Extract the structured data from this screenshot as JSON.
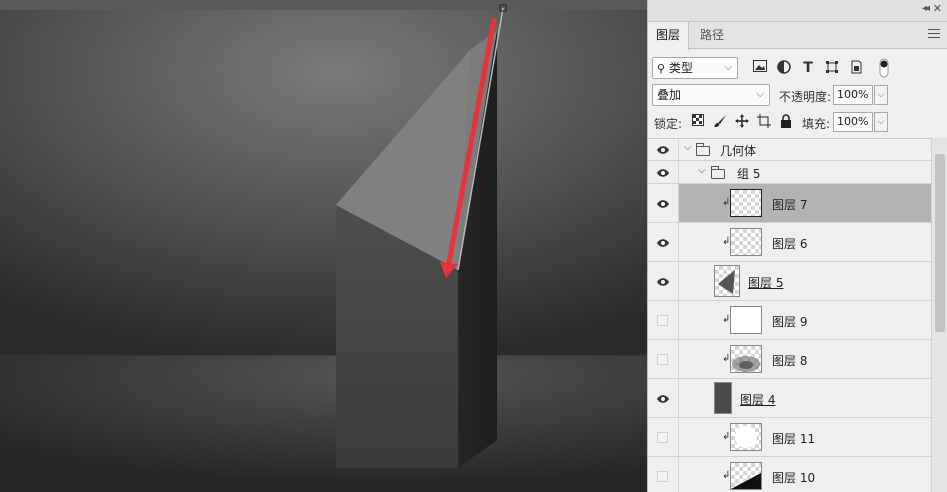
{
  "panel": {
    "tabs": [
      {
        "label": "图层",
        "active": true
      },
      {
        "label": "路径",
        "active": false
      }
    ],
    "filter": {
      "kind_label": "类型"
    },
    "blend_mode": "叠加",
    "opacity_label": "不透明度:",
    "opacity_value": "100%",
    "lock_label": "锁定:",
    "fill_label": "填充:",
    "fill_value": "100%",
    "filter_icons": [
      "image-filter-icon",
      "adjustment-filter-icon",
      "type-filter-icon",
      "shape-filter-icon",
      "smart-object-filter-icon",
      "filter-toggle-icon"
    ],
    "lock_icons": [
      "lock-transparent-pixels-icon",
      "lock-image-pixels-icon",
      "lock-position-icon",
      "lock-artboard-icon",
      "lock-all-icon"
    ]
  },
  "layers": [
    {
      "name": "几何体",
      "type": "group",
      "visible": true,
      "level": 0
    },
    {
      "name": "组 5",
      "type": "group",
      "visible": true,
      "level": 1
    },
    {
      "name": "图层 7",
      "type": "layer",
      "visible": true,
      "clipped": true,
      "selected": true
    },
    {
      "name": "图层 6",
      "type": "layer",
      "visible": true,
      "clipped": true
    },
    {
      "name": "图层 5",
      "type": "layer",
      "visible": true,
      "clipped": false,
      "underline": true
    },
    {
      "name": "图层 9",
      "type": "layer",
      "visible": false,
      "clipped": true
    },
    {
      "name": "图层 8",
      "type": "layer",
      "visible": false,
      "clipped": true
    },
    {
      "name": "图层 4",
      "type": "layer",
      "visible": true,
      "clipped": false,
      "underline": true
    },
    {
      "name": "图层 11",
      "type": "layer",
      "visible": false,
      "clipped": true
    },
    {
      "name": "图层 10",
      "type": "layer",
      "visible": false,
      "clipped": true
    }
  ],
  "colors": {
    "annotation_arrow": "#e8333a",
    "panel_bg": "#efefef",
    "selected_row": "#b3b3b3"
  }
}
